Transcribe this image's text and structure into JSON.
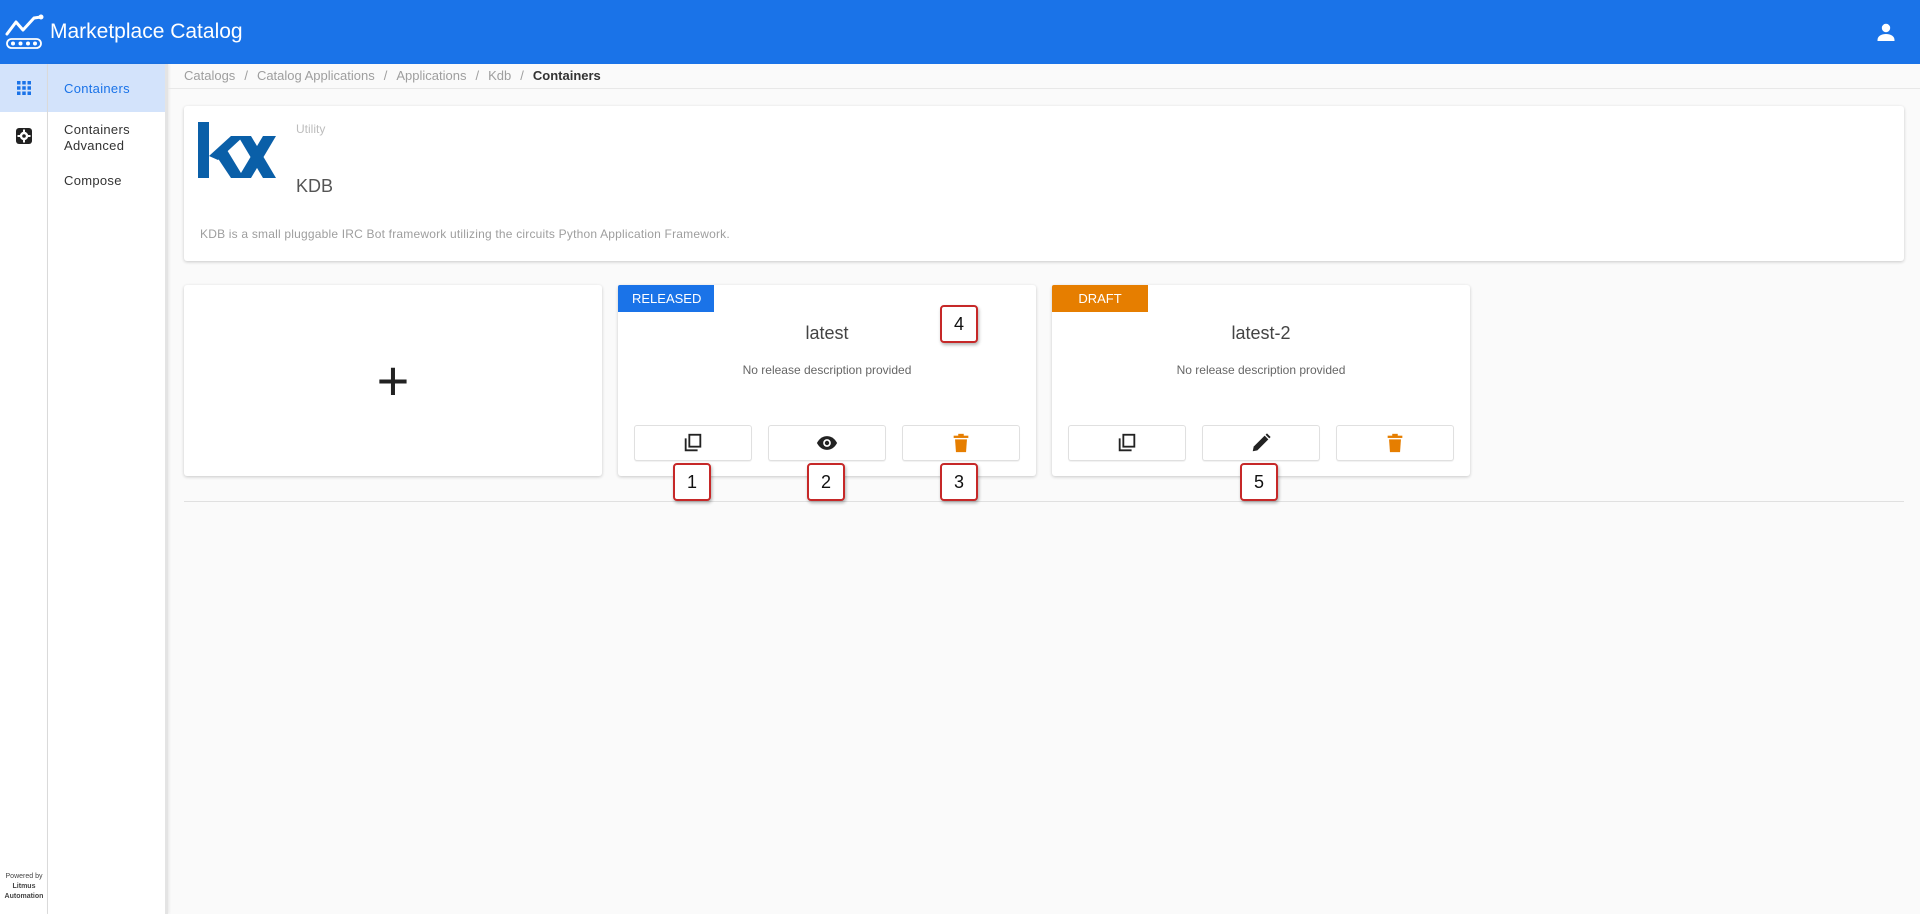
{
  "header": {
    "title": "Marketplace Catalog"
  },
  "colors": {
    "primary": "#1a73e8",
    "released": "#1a73e8",
    "draft": "#e67e00",
    "delete": "#e67e00"
  },
  "rail": {
    "items": [
      {
        "icon": "apps-grid-icon",
        "active": true
      },
      {
        "icon": "settings-box-icon",
        "active": false
      }
    ],
    "powered_by": "Powered by",
    "brand_line1": "Litmus",
    "brand_line2": "Automation"
  },
  "subnav": {
    "items": [
      {
        "label": "Containers"
      },
      {
        "label": "Containers Advanced"
      },
      {
        "label": "Compose"
      }
    ]
  },
  "breadcrumb": {
    "items": [
      "Catalogs",
      "Catalog Applications",
      "Applications",
      "Kdb"
    ],
    "separator": "/",
    "current": "Containers"
  },
  "app": {
    "type": "Utility",
    "name": "KDB",
    "description": "KDB is a small pluggable IRC Bot framework utilizing the circuits Python Application Framework."
  },
  "add_card": {
    "symbol": "+"
  },
  "releases": [
    {
      "status": "RELEASED",
      "version": "latest",
      "description": "No release description provided",
      "actions": [
        "copy-icon",
        "eye-icon",
        "trash-icon"
      ]
    },
    {
      "status": "DRAFT",
      "version": "latest-2",
      "description": "No release description provided",
      "actions": [
        "copy-icon",
        "pencil-icon",
        "trash-icon"
      ]
    }
  ],
  "callouts": [
    "1",
    "2",
    "3",
    "4",
    "5"
  ]
}
